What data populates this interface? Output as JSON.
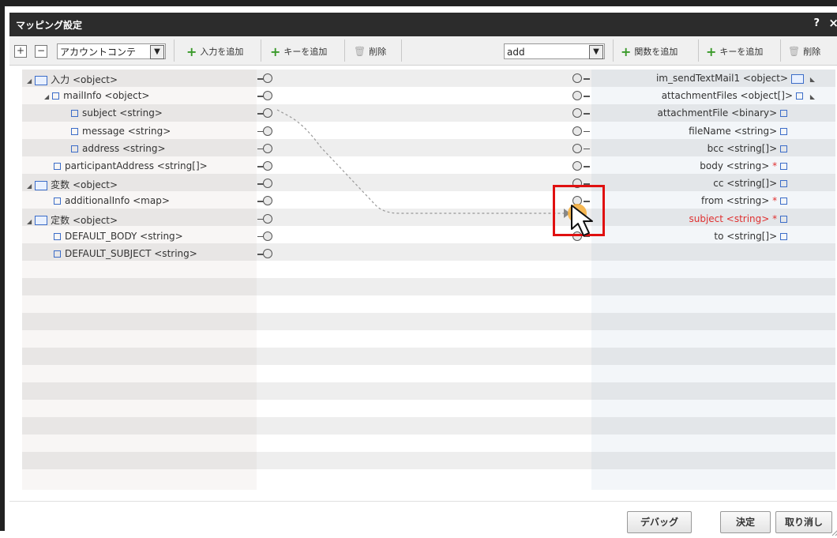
{
  "title": "マッピング設定",
  "titlebar": {
    "help": "?",
    "close": "×"
  },
  "toolbar": {
    "expand": "+",
    "collapse": "−",
    "account_select": "アカウントコンテ",
    "add_input": "入力を追加",
    "add_key_left": "キーを追加",
    "delete_left": "削除",
    "function_select": "add",
    "add_function": "関数を追加",
    "add_key_right": "キーを追加",
    "delete_right": "削除"
  },
  "left_tree": [
    {
      "label": "入力 <object>",
      "indent": 0,
      "type": "folder",
      "expander": "◢"
    },
    {
      "label": "mailInfo <object>",
      "indent": 1,
      "type": "field",
      "expander": "◢"
    },
    {
      "label": "subject <string>",
      "indent": 2,
      "type": "field"
    },
    {
      "label": "message <string>",
      "indent": 2,
      "type": "field"
    },
    {
      "label": "address <string>",
      "indent": 2,
      "type": "field"
    },
    {
      "label": "participantAddress <string[]>",
      "indent": 1,
      "type": "field"
    },
    {
      "label": "変数 <object>",
      "indent": 0,
      "type": "folder",
      "expander": "◢"
    },
    {
      "label": "additionalInfo <map>",
      "indent": 1,
      "type": "field"
    },
    {
      "label": "定数 <object>",
      "indent": 0,
      "type": "folder",
      "expander": "◢"
    },
    {
      "label": "DEFAULT_BODY <string>",
      "indent": 1,
      "type": "field"
    },
    {
      "label": "DEFAULT_SUBJECT <string>",
      "indent": 1,
      "type": "field"
    }
  ],
  "right_tree": [
    {
      "label": "im_sendTextMail1 <object>",
      "required": "",
      "type": "folder",
      "expander": "◣"
    },
    {
      "label": "attachmentFiles <object[]>",
      "required": "",
      "type": "field",
      "expander": "◣"
    },
    {
      "label": "attachmentFile <binary>",
      "required": "",
      "type": "field"
    },
    {
      "label": "fileName <string>",
      "required": "",
      "type": "field"
    },
    {
      "label": "bcc <string[]>",
      "required": "",
      "type": "field"
    },
    {
      "label": "body <string>",
      "required": "*",
      "type": "field"
    },
    {
      "label": "cc <string[]>",
      "required": "",
      "type": "field"
    },
    {
      "label": "from <string>",
      "required": "*",
      "type": "field"
    },
    {
      "label": "subject <string>",
      "required": "*",
      "type": "field",
      "highlight": true
    },
    {
      "label": "to <string[]>",
      "required": "",
      "type": "field"
    }
  ],
  "footer": {
    "debug": "デバッグ",
    "ok": "決定",
    "cancel": "取り消し"
  },
  "colors": {
    "titlebar": "#2c2c2c",
    "required": "#e03030",
    "highlight_box": "#e01010",
    "node_active": "#f5b040"
  }
}
